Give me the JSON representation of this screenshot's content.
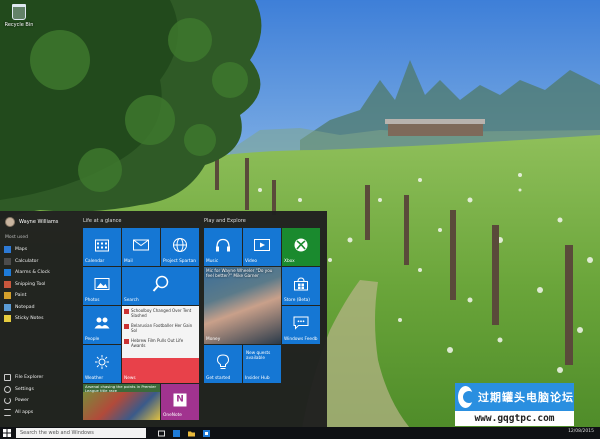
{
  "desktop": {
    "recycle_bin_label": "Recycle Bin"
  },
  "start_menu": {
    "user_name": "Wayne Williams",
    "most_used_label": "Most used",
    "apps": [
      {
        "label": "Maps",
        "color": "#2d7ad6"
      },
      {
        "label": "Calculator",
        "color": "#4c4c4c"
      },
      {
        "label": "Alarms & Clock",
        "color": "#1e7bd8"
      },
      {
        "label": "Snipping Tool",
        "color": "#c8573d"
      },
      {
        "label": "Paint",
        "color": "#d4a02b"
      },
      {
        "label": "Notepad",
        "color": "#5b9bd5"
      },
      {
        "label": "Sticky Notes",
        "color": "#e6cc3f"
      }
    ],
    "system": [
      {
        "label": "File Explorer"
      },
      {
        "label": "Settings"
      },
      {
        "label": "Power"
      },
      {
        "label": "All apps"
      }
    ],
    "groups": {
      "life": "Life at a glance",
      "play": "Play and Explore"
    },
    "tiles": {
      "calendar": "Calendar",
      "mail": "Mail",
      "project_spartan": "Project Spartan",
      "photos": "Photos",
      "search": "Search",
      "people": "People",
      "weather": "Weather",
      "news": "News",
      "news_items": [
        "Schoolboy Changed Over Tent Slashed",
        "Belarusian Footballer Her Gain Sol",
        "Hebrew Film Pulls Out Life Awards"
      ],
      "photo_caption": "Arsenal chasing the points in Premier League title race",
      "onenote": "OneNote",
      "music": "Music",
      "video": "Video",
      "xbox": "Xbox",
      "money": "Money",
      "money_headline": "Mic for Wayne Wheeler \"Do you feel better?\" Mike Garner",
      "store": "Store (Beta)",
      "feedback": "Windows Feedb",
      "get_started": "Get started",
      "insider": "Insider Hub",
      "insider_text": "New quests available"
    }
  },
  "taskbar": {
    "search_placeholder": "Search the web and Windows",
    "clock": "12/08/2015"
  },
  "watermark": {
    "title": "过期罐头电脑论坛",
    "url": "www.gqgtpc.com"
  }
}
